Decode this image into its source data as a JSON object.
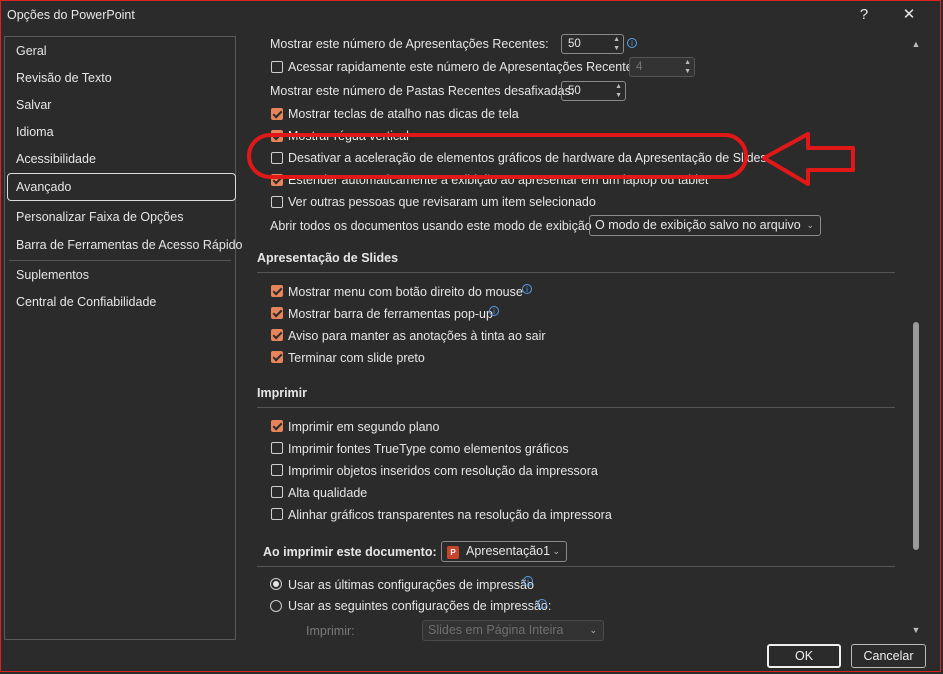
{
  "window": {
    "title": "Opções do PowerPoint",
    "help": "?",
    "close": "✕"
  },
  "sidebar": {
    "items": [
      {
        "label": "Geral"
      },
      {
        "label": "Revisão de Texto"
      },
      {
        "label": "Salvar"
      },
      {
        "label": "Idioma"
      },
      {
        "label": "Acessibilidade"
      },
      {
        "label": "Avançado"
      },
      {
        "label": "Personalizar Faixa de Opções"
      },
      {
        "label": "Barra de Ferramentas de Acesso Rápido"
      },
      {
        "label": "Suplementos"
      },
      {
        "label": "Central de Confiabilidade"
      }
    ],
    "selected": "Avançado"
  },
  "display": {
    "recent_presentations": {
      "label": "Mostrar este número de Apresentações Recentes:",
      "value": "50"
    },
    "quick_access": {
      "label": "Acessar rapidamente este número de Apresentações Recentes:",
      "value": "4",
      "checked": false
    },
    "recent_folders": {
      "label": "Mostrar este número de Pastas Recentes desafixadas:",
      "value": "50"
    },
    "shortcut_keys": {
      "label": "Mostrar teclas de atalho nas dicas de tela",
      "checked": true
    },
    "vertical_ruler": {
      "label": "Mostrar régua vertical",
      "checked": true
    },
    "disable_hw_accel": {
      "label": "Desativar a aceleração de elementos gráficos de hardware da Apresentação de Slides",
      "checked": false
    },
    "auto_extend": {
      "label": "Estender automaticamente a exibição ao apresentar em um laptop ou tablet",
      "checked": true
    },
    "see_reviewers": {
      "label": "Ver outras pessoas que revisaram um item selecionado",
      "checked": false
    },
    "open_view": {
      "label": "Abrir todos os documentos usando este modo de exibição",
      "value": "O modo de exibição salvo no arquivo"
    }
  },
  "slideshow": {
    "heading": "Apresentação de Slides",
    "items": [
      {
        "label": "Mostrar menu com botão direito do mouse",
        "checked": true
      },
      {
        "label": "Mostrar barra de ferramentas pop-up",
        "checked": true
      },
      {
        "label": "Aviso para manter as anotações à tinta ao sair",
        "checked": true
      },
      {
        "label": "Terminar com slide preto",
        "checked": true
      }
    ]
  },
  "print": {
    "heading": "Imprimir",
    "items": [
      {
        "label": "Imprimir em segundo plano",
        "checked": true
      },
      {
        "label": "Imprimir fontes TrueType como elementos gráficos",
        "checked": false
      },
      {
        "label": "Imprimir objetos inseridos com resolução da impressora",
        "checked": false
      },
      {
        "label": "Alta qualidade",
        "checked": false
      },
      {
        "label": "Alinhar gráficos transparentes na resolução da impressora",
        "checked": false
      }
    ]
  },
  "print_doc": {
    "heading": "Ao imprimir este documento:",
    "document": "Apresentação1",
    "radio_last": {
      "label": "Usar as últimas configurações de impressão",
      "selected": true
    },
    "radio_following": {
      "label": "Usar as seguintes configurações de impressão:",
      "selected": false
    },
    "print_label": "Imprimir:",
    "print_value": "Slides em Página Inteira"
  },
  "buttons": {
    "ok": "OK",
    "cancel": "Cancelar"
  },
  "colors": {
    "accent": "#e8845a",
    "annotation": "#e01818",
    "background": "#2b2b2b"
  }
}
